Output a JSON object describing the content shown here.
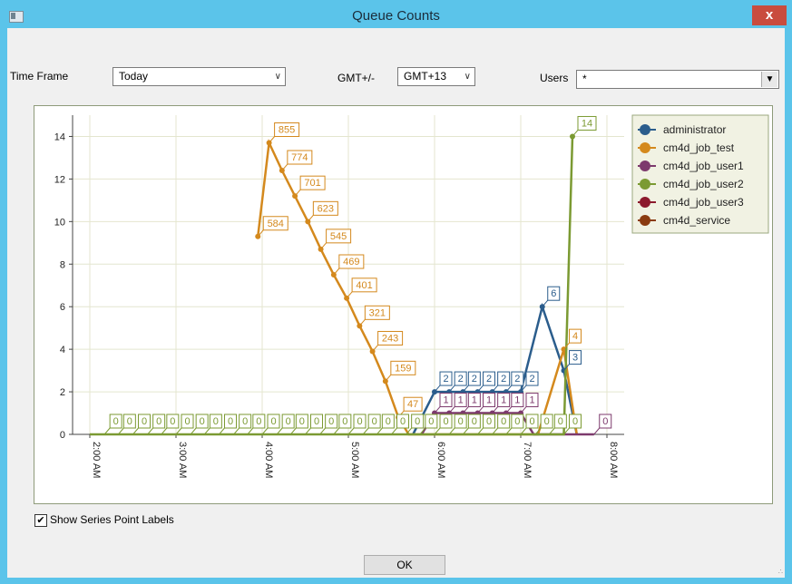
{
  "window": {
    "title": "Queue Counts",
    "close_label": "x"
  },
  "filters": {
    "time_frame_label": "Time Frame",
    "time_frame_value": "Today",
    "gmt_label": "GMT+/-",
    "gmt_value": "GMT+13",
    "users_label": "Users",
    "users_value": "*"
  },
  "show_labels": {
    "checked": true,
    "label": "Show Series Point Labels"
  },
  "ok_label": "OK",
  "chart_data": {
    "type": "line",
    "ylim": [
      0,
      15
    ],
    "yticks": [
      0,
      2,
      4,
      6,
      8,
      10,
      12,
      14
    ],
    "xlim": [
      1.8,
      8.2
    ],
    "xticks": [
      2,
      3,
      4,
      5,
      6,
      7,
      8
    ],
    "xtick_labels": [
      "2:00 AM",
      "3:00 AM",
      "4:00 AM",
      "5:00 AM",
      "6:00 AM",
      "7:00 AM",
      "8:00 AM"
    ],
    "grid": true,
    "legend_position": "top-right",
    "series": [
      {
        "name": "administrator",
        "color": "#2b5d8c",
        "points": [
          [
            5.75,
            0
          ],
          [
            6.0,
            2
          ],
          [
            6.17,
            2
          ],
          [
            6.33,
            2
          ],
          [
            6.5,
            2
          ],
          [
            6.67,
            2
          ],
          [
            6.83,
            2
          ],
          [
            7.0,
            2
          ],
          [
            7.25,
            6
          ],
          [
            7.5,
            3
          ],
          [
            7.65,
            0
          ]
        ],
        "labels": [
          null,
          "2",
          "2",
          "2",
          "2",
          "2",
          "2",
          "2",
          "6",
          "3",
          null
        ]
      },
      {
        "name": "cm4d_job_test",
        "color": "#d4891d",
        "points": [
          [
            3.95,
            9.3
          ],
          [
            4.08,
            13.7
          ],
          [
            4.23,
            12.4
          ],
          [
            4.38,
            11.2
          ],
          [
            4.53,
            10.0
          ],
          [
            4.68,
            8.7
          ],
          [
            4.83,
            7.5
          ],
          [
            4.98,
            6.4
          ],
          [
            5.13,
            5.1
          ],
          [
            5.28,
            3.9
          ],
          [
            5.43,
            2.5
          ],
          [
            5.58,
            0.8
          ],
          [
            5.7,
            0
          ],
          [
            7.2,
            0
          ],
          [
            7.5,
            4
          ],
          [
            7.65,
            0
          ]
        ],
        "labels": [
          "584",
          "855",
          "774",
          "701",
          "623",
          "545",
          "469",
          "401",
          "321",
          "243",
          "159",
          "47",
          null,
          null,
          "4",
          null
        ]
      },
      {
        "name": "cm4d_job_user1",
        "color": "#7d3a6d",
        "points": [
          [
            5.85,
            0
          ],
          [
            6.0,
            1
          ],
          [
            6.17,
            1
          ],
          [
            6.33,
            1
          ],
          [
            6.5,
            1
          ],
          [
            6.67,
            1
          ],
          [
            6.83,
            1
          ],
          [
            7.0,
            1
          ],
          [
            7.15,
            0
          ],
          [
            7.65,
            0
          ],
          [
            7.85,
            0
          ]
        ],
        "labels": [
          null,
          "1",
          "1",
          "1",
          "1",
          "1",
          "1",
          "1",
          null,
          null,
          "0"
        ]
      },
      {
        "name": "cm4d_job_user2",
        "color": "#7b9a32",
        "points": [
          [
            2.0,
            0
          ],
          [
            2.17,
            0
          ],
          [
            2.33,
            0
          ],
          [
            2.5,
            0
          ],
          [
            2.67,
            0
          ],
          [
            2.83,
            0
          ],
          [
            3.0,
            0
          ],
          [
            3.17,
            0
          ],
          [
            3.33,
            0
          ],
          [
            3.5,
            0
          ],
          [
            3.67,
            0
          ],
          [
            3.83,
            0
          ],
          [
            4.0,
            0
          ],
          [
            4.17,
            0
          ],
          [
            4.33,
            0
          ],
          [
            4.5,
            0
          ],
          [
            4.67,
            0
          ],
          [
            4.83,
            0
          ],
          [
            5.0,
            0
          ],
          [
            5.17,
            0
          ],
          [
            5.33,
            0
          ],
          [
            5.5,
            0
          ],
          [
            5.67,
            0
          ],
          [
            5.83,
            0
          ],
          [
            6.0,
            0
          ],
          [
            6.17,
            0
          ],
          [
            6.33,
            0
          ],
          [
            6.5,
            0
          ],
          [
            6.67,
            0
          ],
          [
            6.83,
            0
          ],
          [
            7.0,
            0
          ],
          [
            7.17,
            0
          ],
          [
            7.33,
            0
          ],
          [
            7.5,
            0
          ],
          [
            7.6,
            14
          ]
        ],
        "labels": [
          null,
          "0",
          "0",
          "0",
          "0",
          "0",
          "0",
          "0",
          "0",
          "0",
          "0",
          "0",
          "0",
          "0",
          "0",
          "0",
          "0",
          "0",
          "0",
          "0",
          "0",
          "0",
          "0",
          "0",
          "0",
          "0",
          "0",
          "0",
          "0",
          "0",
          "0",
          "0",
          "0",
          "0",
          "14"
        ]
      },
      {
        "name": "cm4d_job_user3",
        "color": "#8c1a2d",
        "points": [],
        "labels": []
      },
      {
        "name": "cm4d_service",
        "color": "#8a3b10",
        "points": [],
        "labels": []
      }
    ]
  }
}
